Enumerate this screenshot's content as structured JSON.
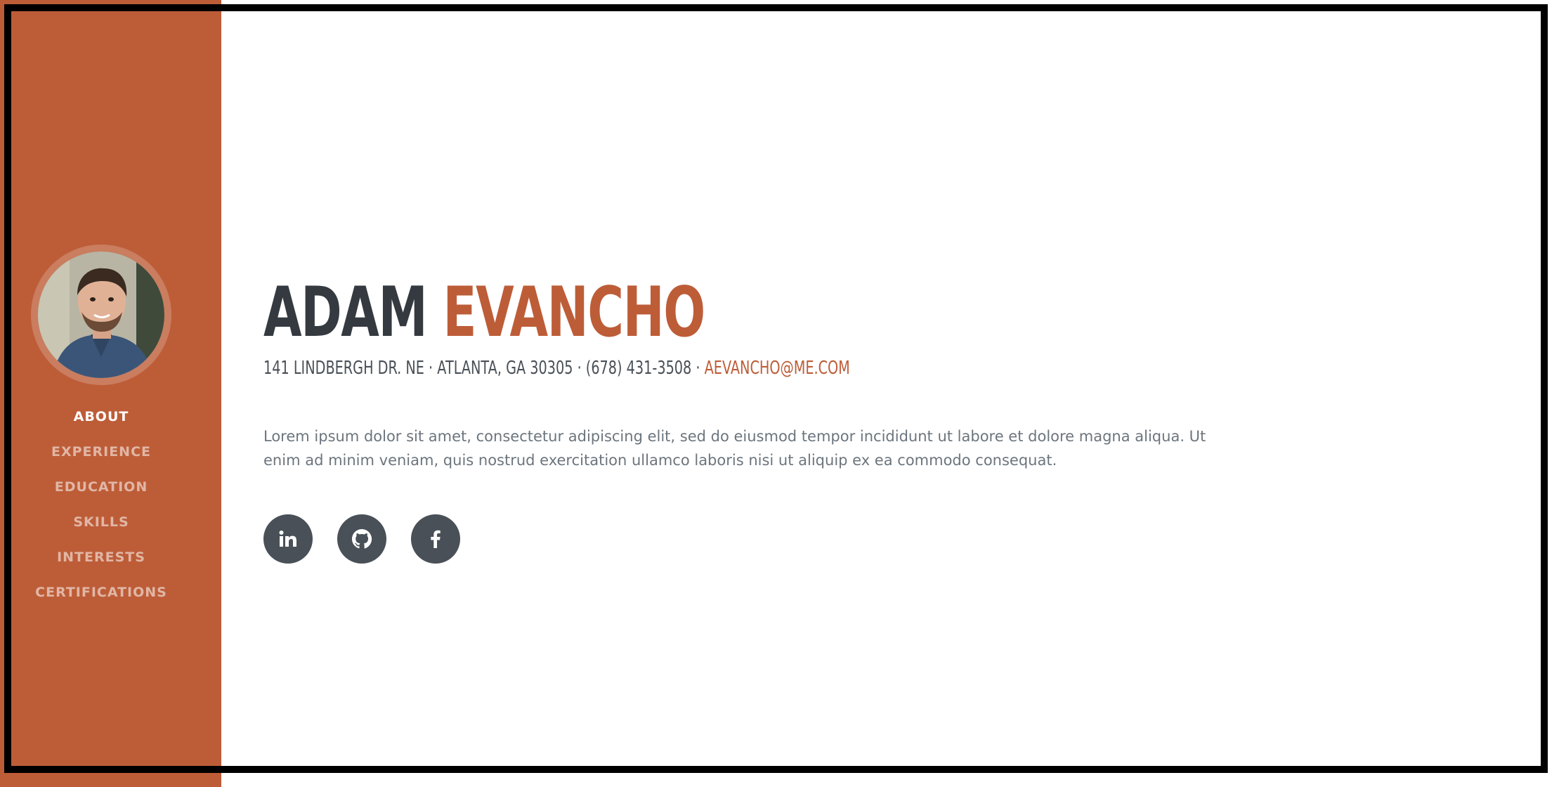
{
  "sidebar": {
    "avatar_alt": "Adam Evancho profile photo",
    "nav": [
      {
        "label": "ABOUT",
        "active": true
      },
      {
        "label": "EXPERIENCE",
        "active": false
      },
      {
        "label": "EDUCATION",
        "active": false
      },
      {
        "label": "SKILLS",
        "active": false
      },
      {
        "label": "INTERESTS",
        "active": false
      },
      {
        "label": "CERTIFICATIONS",
        "active": false
      }
    ]
  },
  "about": {
    "first_name": "ADAM",
    "last_name": "EVANCHO",
    "address": "141 LINDBERGH DR. NE · ATLANTA, GA 30305 · (678) 431-3508 ·",
    "email": "AEVANCHO@ME.COM",
    "lead": "Lorem ipsum dolor sit amet, consectetur adipiscing elit, sed do eiusmod tempor incididunt ut labore et dolore magna aliqua. Ut enim ad minim veniam, quis nostrud exercitation ullamco laboris nisi ut aliquip ex ea commodo consequat."
  },
  "social": [
    {
      "icon": "linkedin-icon"
    },
    {
      "icon": "github-icon"
    },
    {
      "icon": "facebook-icon"
    }
  ],
  "colors": {
    "primary": "#bd5d38",
    "dark": "#343a40",
    "icon_bg": "#495057",
    "text_muted": "#6c757d"
  }
}
